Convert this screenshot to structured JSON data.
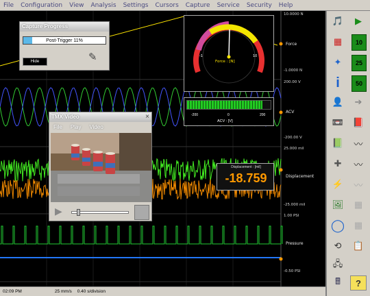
{
  "menu": [
    "File",
    "Configuration",
    "View",
    "Analysis",
    "Settings",
    "Cursors",
    "Capture",
    "Service",
    "Security",
    "Help"
  ],
  "channels": {
    "force": {
      "name": "Force",
      "top": "10.0000 N",
      "bottom": "-1.0000 N"
    },
    "acv": {
      "name": "ACV",
      "top": "200.00 V",
      "bottom": "-200.00 V"
    },
    "displacement": {
      "name": "Displacement",
      "top": "25.000 mil",
      "bottom": "-25.000 mil"
    },
    "pressure": {
      "name": "Pressure",
      "top": "1.00 PSI",
      "bottom": "-0.50 PSI"
    }
  },
  "capture": {
    "title": "Capture Progress",
    "progress_text": "Post-Trigger 11%",
    "progress_percent": 11,
    "hide_label": "Hide"
  },
  "gauge": {
    "label": "Force : [N]",
    "min": "-1",
    "max": "10",
    "value": 10,
    "ticks": [
      "0",
      "2",
      "4",
      "6",
      "8"
    ]
  },
  "bar": {
    "label": "ACV : [V]",
    "min": "-200",
    "mid": "0",
    "max": "200",
    "value": 90
  },
  "video": {
    "title": "TMX Video",
    "menu": [
      "File",
      "Play",
      "Video"
    ],
    "close": "×",
    "slider_percent": 8
  },
  "displacement_meter": {
    "label": "Displacement : [mil]",
    "value": "-18.759"
  },
  "status": {
    "time": "02:09 PM",
    "speed": "25 mm/s",
    "division": "0.40 s/division"
  },
  "side_buttons": {
    "b1": "10",
    "b2": "25",
    "b3": "50"
  },
  "colors": {
    "force": "#ffe600",
    "acv_green": "#33cc33",
    "acv_blue": "#4455ff",
    "displacement_green": "#44ee22",
    "displacement_orange": "#ee8800",
    "pressure_green": "#22cc33",
    "pressure_blue": "#2277ff",
    "meter_text": "#ff9900"
  }
}
